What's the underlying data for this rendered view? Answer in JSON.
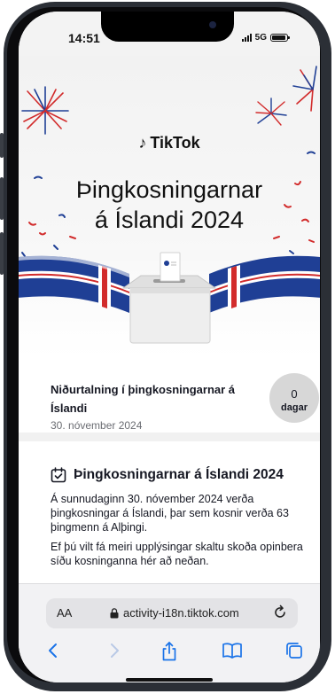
{
  "status_bar": {
    "time": "14:51",
    "network": "5G"
  },
  "banner": {
    "brand": "TikTok",
    "title_line1": "Þingkosningarnar",
    "title_line2": "á Íslandi 2024"
  },
  "countdown": {
    "title": "Niðurtalning í þingkosningarnar á Íslandi",
    "date": "30. nóvember 2024",
    "days_value": "0",
    "days_label": "dagar"
  },
  "info": {
    "title": "Þingkosningarnar á Íslandi 2024",
    "paragraph1": "Á sunnudaginn 30. nóvember 2024 verða þingkosningar á Íslandi, þar sem kosnir verða 63 þingmenn á Alþingi.",
    "paragraph2": "Ef þú vilt fá meiri upplýsingar skaltu skoða opinbera síðu kosninganna hér að neðan."
  },
  "browser": {
    "aa_label": "AA",
    "url": "activity-i18n.tiktok.com"
  },
  "colors": {
    "flag_blue": "#1f3f95",
    "flag_red": "#d22c2c",
    "text": "#161823"
  }
}
